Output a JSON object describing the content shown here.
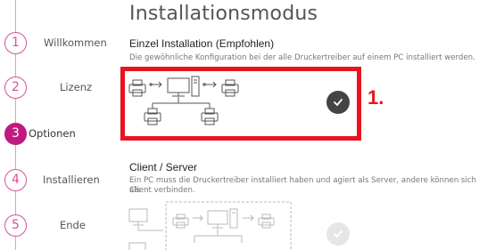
{
  "page": {
    "title": "Installationsmodus"
  },
  "steps": [
    {
      "number": "1",
      "label": "Willkommen",
      "active": false
    },
    {
      "number": "2",
      "label": "Lizenz",
      "active": false
    },
    {
      "number": "3",
      "label": "Optionen",
      "active": true
    },
    {
      "number": "4",
      "label": "Installieren",
      "active": false
    },
    {
      "number": "5",
      "label": "Ende",
      "active": false
    }
  ],
  "options": {
    "single": {
      "title": "Einzel Installation (Empfohlen)",
      "description": "Die gewöhnliche Konfiguration bei der alle Druckertreiber auf einem PC installiert werden.",
      "selected": true
    },
    "client_server": {
      "title": "Client / Server",
      "description_line1": "Ein PC muss die Druckertreiber installiert haben und agiert als Server, andere können sich als",
      "description_line2": "Client verbinden.",
      "selected": false
    }
  },
  "annotation": {
    "label": "1."
  },
  "colors": {
    "accent": "#c2187f",
    "highlight": "#e8141f",
    "check_selected": "#444444"
  },
  "icons": [
    "printer-icon",
    "usb-icon",
    "monitor-icon",
    "tower-icon",
    "network-icon",
    "check-icon"
  ]
}
